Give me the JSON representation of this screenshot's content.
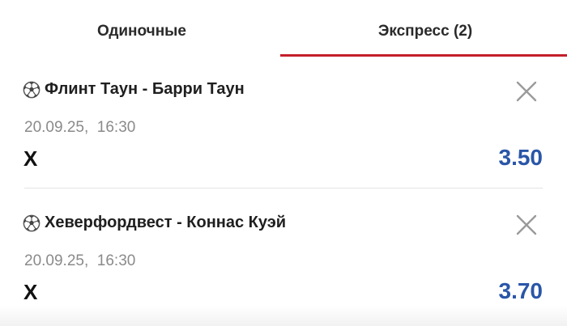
{
  "tabs": [
    {
      "label": "Одиночные",
      "active": false
    },
    {
      "label": "Экспресс (2)",
      "active": true
    }
  ],
  "bets": [
    {
      "match": "Флинт Таун - Барри Таун",
      "date": "20.09.25,  16:30",
      "outcome": "Х",
      "odds": "3.50",
      "sport_icon": "soccer-ball-icon",
      "remove_icon": "close-icon"
    },
    {
      "match": "Хеверфордвест - Коннас Куэй",
      "date": "20.09.25,  16:30",
      "outcome": "Х",
      "odds": "3.70",
      "sport_icon": "soccer-ball-icon",
      "remove_icon": "close-icon"
    }
  ],
  "colors": {
    "accent_red": "#c41e2a",
    "odds_blue": "#2a56a8",
    "date_gray": "#8a8a8a",
    "divider": "#e3e3e3"
  }
}
